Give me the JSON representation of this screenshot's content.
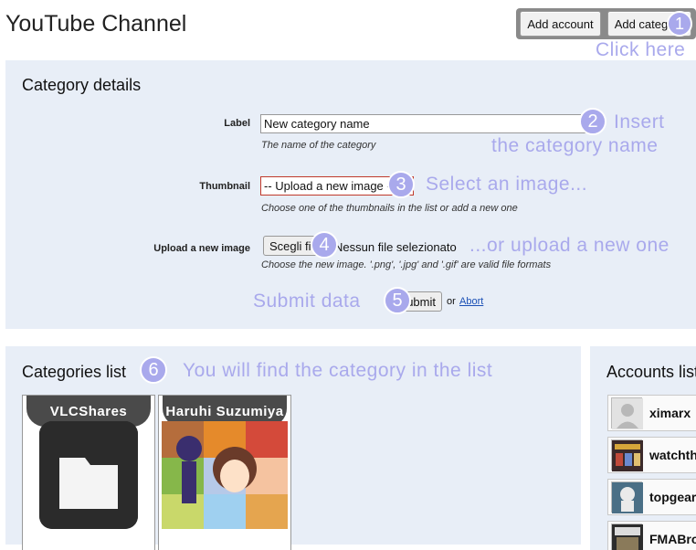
{
  "page": {
    "title": "YouTube Channel"
  },
  "toolbar": {
    "add_account": "Add account",
    "add_category": "Add category"
  },
  "tips": {
    "click_here": "Click here",
    "insert_name_1": "Insert",
    "insert_name_2": "the category name",
    "select_image": "Select an image...",
    "upload_new": "...or upload a new one",
    "submit_data": "Submit data",
    "find_in_list": "You will find the category in the list"
  },
  "steps": [
    "1",
    "2",
    "3",
    "4",
    "5",
    "6"
  ],
  "form": {
    "title": "Category details",
    "label_field": {
      "label": "Label",
      "value": "New category name",
      "hint": "The name of the category"
    },
    "thumbnail_field": {
      "label": "Thumbnail",
      "selected": "-- Upload a new image --",
      "hint": "Choose one of the thumbnails in the list or add a new one"
    },
    "upload_field": {
      "label": "Upload a new image",
      "button": "Scegli file",
      "status": "Nessun file selezionato",
      "hint": "Choose the new image. '.png', '.jpg' and '.gif' are valid file formats"
    },
    "submit": "Submit",
    "or": "or",
    "abort": "Abort"
  },
  "categories": {
    "title": "Categories list",
    "items": [
      {
        "name": "VLCShares"
      },
      {
        "name": "Haruhi Suzumiya"
      }
    ]
  },
  "accounts": {
    "title": "Accounts list",
    "items": [
      {
        "name": "ximarx"
      },
      {
        "name": "watchth"
      },
      {
        "name": "topgear"
      },
      {
        "name": "FMABro"
      }
    ]
  }
}
